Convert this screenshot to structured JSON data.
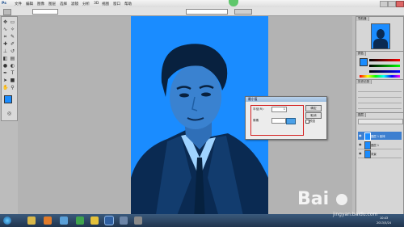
{
  "app": {
    "name": "Photoshop"
  },
  "menubar": {
    "items": [
      "Ps",
      "文件",
      "编辑",
      "图像",
      "图层",
      "选择",
      "滤镜",
      "分析",
      "3D",
      "视图",
      "窗口",
      "帮助"
    ]
  },
  "dialog": {
    "title": "最小值",
    "fields": [
      {
        "label": "半径(R):",
        "value": "1"
      },
      {
        "label": "像素",
        "value": ""
      }
    ],
    "buttons": {
      "ok": "确定",
      "cancel": "取消",
      "preview": "预览"
    }
  },
  "panels": {
    "navigator_tab": "导航器",
    "color_tab": "颜色",
    "history_tab": "历史记录",
    "layers_tab": "图层",
    "layers": [
      {
        "name": "图层 1 副本"
      },
      {
        "name": "图层 1"
      },
      {
        "name": "背景"
      }
    ]
  },
  "taskbar": {
    "time": "10:43",
    "date": "2013/3/24"
  },
  "watermark": {
    "brand": "Bai",
    "sub": "jingyan.baidu.com"
  },
  "colors": {
    "canvas": "#1a8cff",
    "highlight_box": "#d42020"
  }
}
